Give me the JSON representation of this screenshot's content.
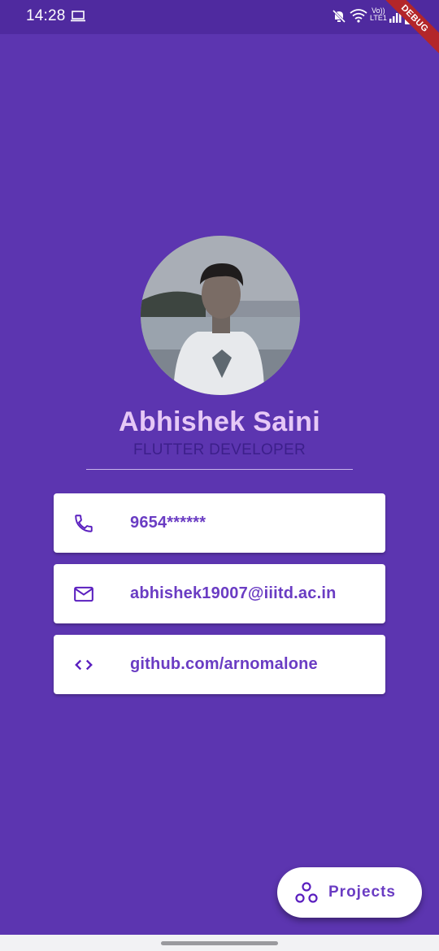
{
  "status_bar": {
    "time": "14:28",
    "network_label_top": "Vo))",
    "network_label_bottom": "LTE1",
    "icons": [
      "laptop-icon",
      "mute-icon",
      "wifi-icon",
      "signal-icon",
      "battery-icon"
    ]
  },
  "debug_banner": "DEBUG",
  "profile": {
    "avatar_icon": "profile-photo",
    "name": "Abhishek Saini",
    "title": "FLUTTER DEVELOPER"
  },
  "contacts": [
    {
      "icon": "phone-icon",
      "text": "9654******"
    },
    {
      "icon": "mail-icon",
      "text": "abhishek19007@iiitd.ac.in"
    },
    {
      "icon": "code-icon",
      "text": "github.com/arnomalone"
    }
  ],
  "fab": {
    "icon": "bubble-chart-icon",
    "label": "Projects"
  },
  "colors": {
    "background": "#5c35b0",
    "status_bar": "#4f2a9f",
    "name": "#e6c8f6",
    "subtitle": "#3c1f8a",
    "accent": "#6a3cc3",
    "card": "#ffffff"
  }
}
